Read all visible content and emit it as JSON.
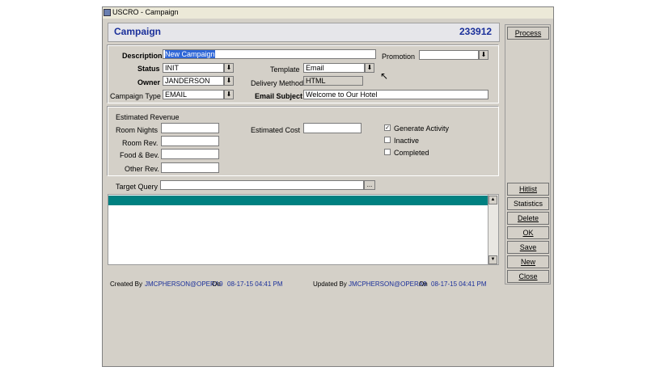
{
  "window": {
    "title": "USCRO - Campaign"
  },
  "header": {
    "title": "Campaign",
    "id": "233912"
  },
  "form": {
    "description": {
      "label": "Description",
      "value": "New Campaign"
    },
    "promotion": {
      "label": "Promotion",
      "value": ""
    },
    "status": {
      "label": "Status",
      "value": "INIT"
    },
    "template": {
      "label": "Template",
      "value": "Email"
    },
    "owner": {
      "label": "Owner",
      "value": "JANDERSON"
    },
    "delivery_method": {
      "label": "Delivery Method",
      "value": "HTML"
    },
    "campaign_type": {
      "label": "Campaign Type",
      "value": "EMAIL"
    },
    "email_subject": {
      "label": "Email Subject",
      "value": "Welcome to Our Hotel"
    }
  },
  "revenue": {
    "section_label": "Estimated Revenue",
    "room_nights": {
      "label": "Room Nights",
      "value": ""
    },
    "room_rev": {
      "label": "Room Rev.",
      "value": ""
    },
    "food_bev": {
      "label": "Food & Bev.",
      "value": ""
    },
    "other_rev": {
      "label": "Other Rev.",
      "value": ""
    },
    "estimated_cost": {
      "label": "Estimated Cost",
      "value": ""
    },
    "generate_activity": {
      "label": "Generate Activity",
      "checked": true
    },
    "inactive": {
      "label": "Inactive",
      "checked": false
    },
    "completed": {
      "label": "Completed",
      "checked": false
    }
  },
  "target_query": {
    "label": "Target Query",
    "value": "",
    "browse_label": "..."
  },
  "buttons": {
    "process": "Process",
    "hitlist": "Hitlist",
    "statistics": "Statistics",
    "delete": "Delete",
    "ok": "OK",
    "save": "Save",
    "new": "New",
    "close": "Close"
  },
  "footer": {
    "created_by_label": "Created By",
    "created_by": "JMCPHERSON@OPERA9",
    "created_on_label": "On",
    "created_on": "08-17-15 04:41 PM",
    "updated_by_label": "Updated By",
    "updated_by": "JMCPHERSON@OPERA9",
    "updated_on_label": "On",
    "updated_on": "08-17-15 04:41 PM"
  },
  "colors": {
    "accent": "#1a2f9a",
    "grid_header": "#008080",
    "window_bg": "#d4d0c8"
  },
  "icons": {
    "dropdown": "chevron-down-icon",
    "scroll_up": "arrow-up-icon",
    "scroll_down": "arrow-down-icon",
    "check": "checkmark-icon"
  }
}
